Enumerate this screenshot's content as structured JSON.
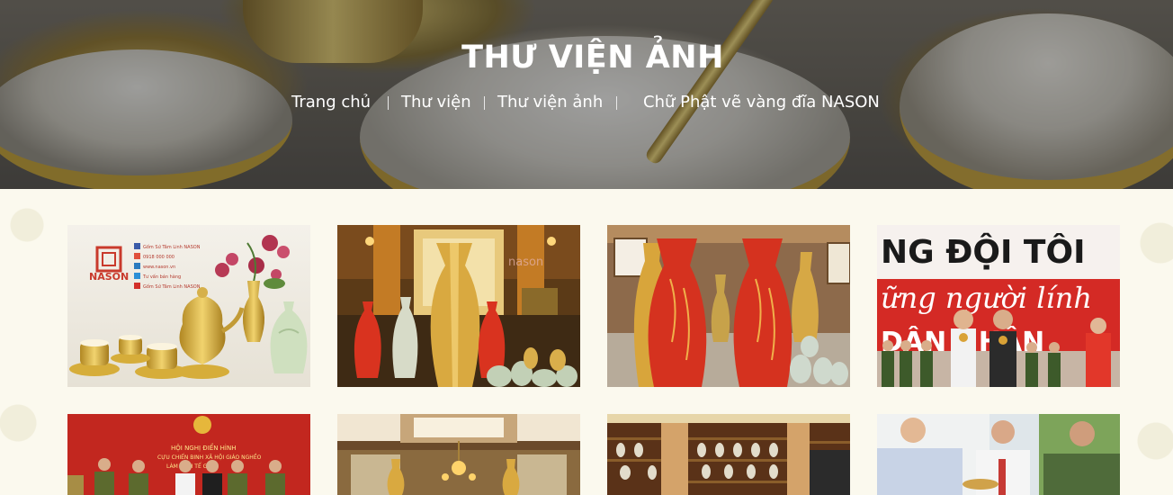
{
  "hero": {
    "title": "THƯ VIỆN ẢNH",
    "breadcrumb": [
      {
        "label": "Trang chủ"
      },
      {
        "label": "Thư viện"
      },
      {
        "label": "Thư viện ảnh"
      },
      {
        "label": "Chữ Phật vẽ vàng đĩa NASON"
      }
    ]
  },
  "gallery": {
    "photo1": {
      "brand": "NASON",
      "contacts": [
        "Gốm Sứ Tâm Linh NASON",
        "0918 000 000",
        "www.nason.vn",
        "Tư vấn bán hàng",
        "Gốm Sứ Tâm Linh NASON"
      ]
    },
    "photo2": {
      "watermark": "nason"
    },
    "photo4": {
      "banner_line1": "NG ĐỘI TÔI",
      "banner_line2": "ững người lính",
      "banner_line3": "DÂN NHÂN"
    },
    "photo5": {
      "banner_line1": "HỘI NGHỊ ĐIỂN HÌNH",
      "banner_line2": "CỰU CHIẾN BINH XÃ HỘI GIÁO NGHỀO",
      "banner_line3": "LÀM KINH TẾ GIỎI"
    }
  },
  "colors": {
    "gold": "#c9a23a",
    "red_vase": "#d8321f",
    "banner_red": "#d52a25"
  }
}
